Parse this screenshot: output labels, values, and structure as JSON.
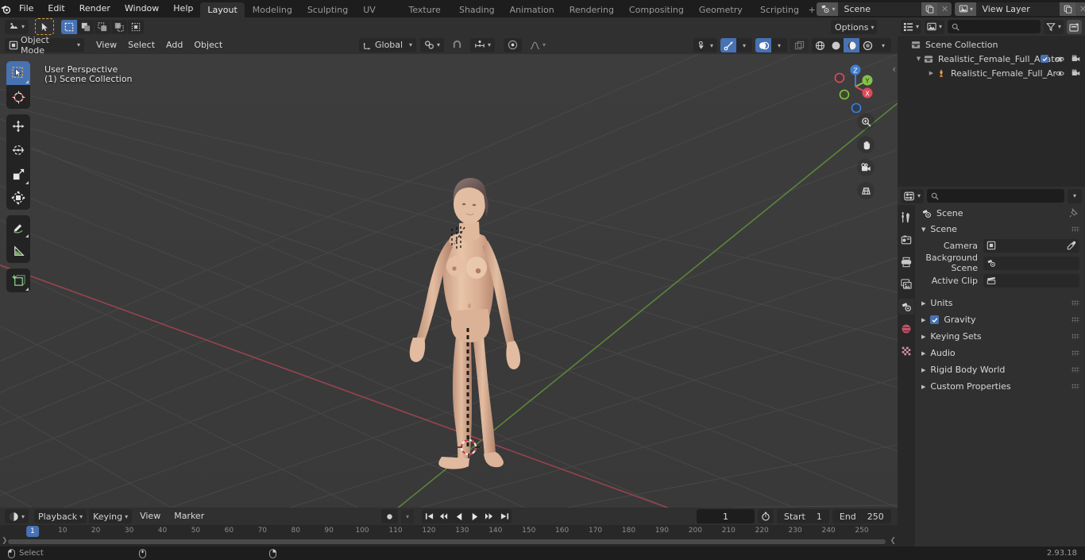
{
  "app": {
    "name": "Blender",
    "version": "2.93.18"
  },
  "topbar": {
    "menus": [
      "File",
      "Edit",
      "Render",
      "Window",
      "Help"
    ],
    "workspaces": [
      {
        "label": "Layout",
        "active": true
      },
      {
        "label": "Modeling",
        "active": false
      },
      {
        "label": "Sculpting",
        "active": false
      },
      {
        "label": "UV Editing",
        "active": false
      },
      {
        "label": "Texture Paint",
        "active": false
      },
      {
        "label": "Shading",
        "active": false
      },
      {
        "label": "Animation",
        "active": false
      },
      {
        "label": "Rendering",
        "active": false
      },
      {
        "label": "Compositing",
        "active": false
      },
      {
        "label": "Geometry Nodes",
        "active": false
      },
      {
        "label": "Scripting",
        "active": false
      }
    ],
    "add_workspace": "+",
    "scene_datablock": {
      "value": "Scene",
      "icon": "scene-icon"
    },
    "viewlayer_datablock": {
      "value": "View Layer",
      "icon": "viewlayer-icon"
    }
  },
  "viewport_header": {
    "editor_type_icon": "editor-type-icon",
    "cursor_tool_icon": "cursor-icon",
    "select_modes": [
      "select-box",
      "select-extend",
      "select-subtract",
      "select-invert",
      "select-intersect"
    ],
    "mode": "Object Mode",
    "menus": [
      "View",
      "Select",
      "Add",
      "Object"
    ],
    "transform_orientation": "Global",
    "snap_icon": "magnet-icon",
    "proportional_icon": "proportional-icon",
    "options_label": "Options",
    "visibility_icon": "visibility-icon",
    "gizmo_icon": "gizmo-icon",
    "overlays_icon": "overlays-icon",
    "xray_icon": "xray-icon",
    "shading_modes": [
      "wireframe",
      "solid",
      "material-preview",
      "rendered"
    ],
    "shading_active": "material-preview"
  },
  "viewport": {
    "perspective_label": "User Perspective",
    "collection_label": "(1) Scene Collection",
    "gizmo_axes": [
      {
        "name": "Z",
        "color": "#3e7fd4",
        "filled": true
      },
      {
        "name": "Y",
        "color": "#85c24b",
        "filled": true
      },
      {
        "name": "X",
        "color": "#e0495a",
        "filled": true
      }
    ],
    "nav_buttons": [
      "zoom-icon",
      "pan-hand-icon",
      "camera-icon",
      "ortho-persp-icon"
    ],
    "toolbar_tools": [
      {
        "name": "tweak-select-tool",
        "active": true
      },
      {
        "name": "cursor-tool",
        "active": false
      },
      {
        "name": "move-tool",
        "active": false
      },
      {
        "name": "rotate-tool",
        "active": false
      },
      {
        "name": "scale-tool",
        "active": false
      },
      {
        "name": "transform-tool",
        "active": false
      },
      {
        "name": "annotate-tool",
        "active": false
      },
      {
        "name": "measure-tool",
        "active": false
      },
      {
        "name": "add-cube-tool",
        "active": false
      }
    ]
  },
  "outliner": {
    "display_mode_icon": "outliner-display-icon",
    "filter_icon": "filter-icon",
    "new_collection_icon": "new-collection-icon",
    "search_placeholder": "",
    "rows": [
      {
        "name": "Scene Collection",
        "icon": "collection-icon",
        "indent": 0,
        "expand": "",
        "checkbox": false,
        "eye": false,
        "camera": false
      },
      {
        "name": "Realistic_Female_Full_Anator",
        "icon": "collection-icon",
        "indent": 1,
        "expand": "down",
        "checkbox": true,
        "eye": true,
        "camera": true
      },
      {
        "name": "Realistic_Female_Full_Ar",
        "icon": "armature-icon",
        "indent": 2,
        "expand": "right",
        "checkbox": false,
        "eye": true,
        "camera": true
      }
    ]
  },
  "properties": {
    "editor_icon": "properties-editor-icon",
    "search_placeholder": "",
    "tabs": [
      {
        "name": "tool-tab",
        "active": false
      },
      {
        "name": "render-tab",
        "active": false
      },
      {
        "name": "output-tab",
        "active": false
      },
      {
        "name": "view-layer-tab",
        "active": false
      },
      {
        "name": "scene-tab",
        "active": true
      },
      {
        "name": "world-tab",
        "active": false
      },
      {
        "name": "texture-tab",
        "active": false
      }
    ],
    "breadcrumb": "Scene",
    "panels": [
      {
        "label": "Scene",
        "open": true
      },
      {
        "label": "Units",
        "open": false
      },
      {
        "label": "Gravity",
        "open": false,
        "checkbox": true
      },
      {
        "label": "Keying Sets",
        "open": false
      },
      {
        "label": "Audio",
        "open": false
      },
      {
        "label": "Rigid Body World",
        "open": false
      },
      {
        "label": "Custom Properties",
        "open": false
      }
    ],
    "scene_fields": [
      {
        "label": "Camera",
        "value": "",
        "icon": "camera-data-icon",
        "eyedropper": true
      },
      {
        "label": "Background Scene",
        "value": "",
        "icon": "scene-icon",
        "eyedropper": false
      },
      {
        "label": "Active Clip",
        "value": "",
        "icon": "clip-icon",
        "eyedropper": false
      }
    ]
  },
  "timeline": {
    "editor_icon": "timeline-editor-icon",
    "menus": [
      "Playback",
      "Keying",
      "View",
      "Marker"
    ],
    "record_icon": "record-icon",
    "transport": [
      "jump-start",
      "prev-keyframe",
      "play-reverse",
      "play",
      "next-keyframe",
      "jump-end"
    ],
    "current_frame": "1",
    "auto_key_icon": "stopwatch-icon",
    "start_label": "Start",
    "start_value": "1",
    "end_label": "End",
    "end_value": "250",
    "playhead_frame": "1",
    "ticks": [
      10,
      20,
      30,
      40,
      50,
      60,
      70,
      80,
      90,
      100,
      110,
      120,
      130,
      140,
      150,
      160,
      170,
      180,
      190,
      200,
      210,
      220,
      230,
      240,
      250
    ]
  },
  "statusbar": {
    "items": [
      {
        "icon": "mouse-left-icon",
        "label": "Select"
      },
      {
        "icon": "mouse-middle-icon",
        "label": ""
      },
      {
        "icon": "mouse-right-icon",
        "label": ""
      }
    ],
    "version": "2.93.18"
  },
  "colors": {
    "accent": "#4772b3",
    "axis_x": "#e0495a",
    "axis_y": "#85c24b",
    "axis_z": "#3e7fd4",
    "header_bg": "#303030",
    "viewport_bg": "#3b3b3b",
    "panel_bg": "#282828"
  }
}
